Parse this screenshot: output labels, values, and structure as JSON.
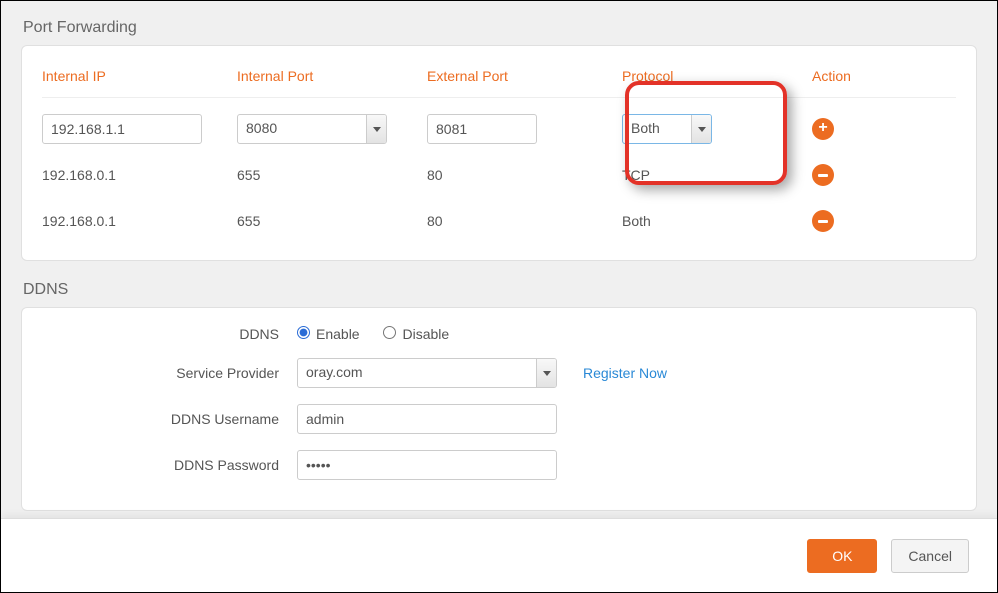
{
  "portForwarding": {
    "title": "Port Forwarding",
    "headers": {
      "internalIp": "Internal IP",
      "internalPort": "Internal Port",
      "externalPort": "External Port",
      "protocol": "Protocol",
      "action": "Action"
    },
    "input": {
      "internalIp": "192.168.1.1",
      "internalPort": "8080",
      "externalPort": "8081",
      "protocol": "Both"
    },
    "rows": [
      {
        "internalIp": "192.168.0.1",
        "internalPort": "655",
        "externalPort": "80",
        "protocol": "TCP"
      },
      {
        "internalIp": "192.168.0.1",
        "internalPort": "655",
        "externalPort": "80",
        "protocol": "Both"
      }
    ]
  },
  "ddns": {
    "title": "DDNS",
    "labels": {
      "ddns": "DDNS",
      "enable": "Enable",
      "disable": "Disable",
      "provider": "Service Provider",
      "register": "Register Now",
      "username": "DDNS Username",
      "password": "DDNS Password"
    },
    "values": {
      "provider": "oray.com",
      "username": "admin",
      "password": "•••••",
      "ddnsEnabled": true
    }
  },
  "footer": {
    "ok": "OK",
    "cancel": "Cancel"
  }
}
